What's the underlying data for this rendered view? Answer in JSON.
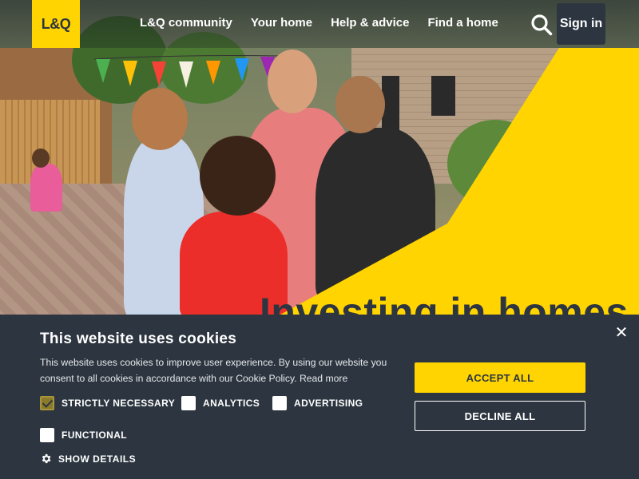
{
  "header": {
    "logo_text": "L&Q",
    "nav": [
      {
        "label": "L&Q community"
      },
      {
        "label": "Your home"
      },
      {
        "label": "Help & advice"
      },
      {
        "label": "Find a home"
      }
    ],
    "search_icon": "search-icon",
    "sign_in_label": "Sign in"
  },
  "hero": {
    "title": "Investing in homes"
  },
  "cookie_banner": {
    "title": "This website uses cookies",
    "text": "This website uses cookies to improve user experience. By using our website you consent to all cookies in accordance with our Cookie Policy.",
    "read_more": "Read more",
    "categories": [
      {
        "label": "STRICTLY NECESSARY",
        "checked": true
      },
      {
        "label": "ANALYTICS",
        "checked": false
      },
      {
        "label": "ADVERTISING",
        "checked": false
      },
      {
        "label": "FUNCTIONAL",
        "checked": false
      }
    ],
    "show_details": "SHOW DETAILS",
    "accept_all": "ACCEPT ALL",
    "decline_all": "DECLINE ALL",
    "close_icon": "close-icon",
    "gear_icon": "gear-icon"
  },
  "colors": {
    "brand_yellow": "#ffd400",
    "banner_bg": "#2d3640",
    "text_light": "#ffffff"
  }
}
